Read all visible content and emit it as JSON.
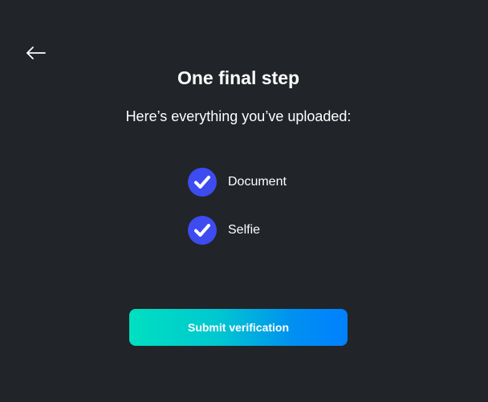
{
  "header": {
    "back_icon": "arrow-left-icon",
    "title": "One final step",
    "subtitle": "Here’s everything you’ve uploaded:"
  },
  "uploads": {
    "items": [
      {
        "label": "Document",
        "icon": "check-circle-icon",
        "status": "uploaded"
      },
      {
        "label": "Selfie",
        "icon": "check-circle-icon",
        "status": "uploaded"
      }
    ]
  },
  "actions": {
    "submit_label": "Submit verification"
  },
  "colors": {
    "background": "#212429",
    "check_circle": "#3d4bf0",
    "button_gradient_start": "#00e0c0",
    "button_gradient_end": "#0080ff",
    "text": "#ffffff"
  }
}
